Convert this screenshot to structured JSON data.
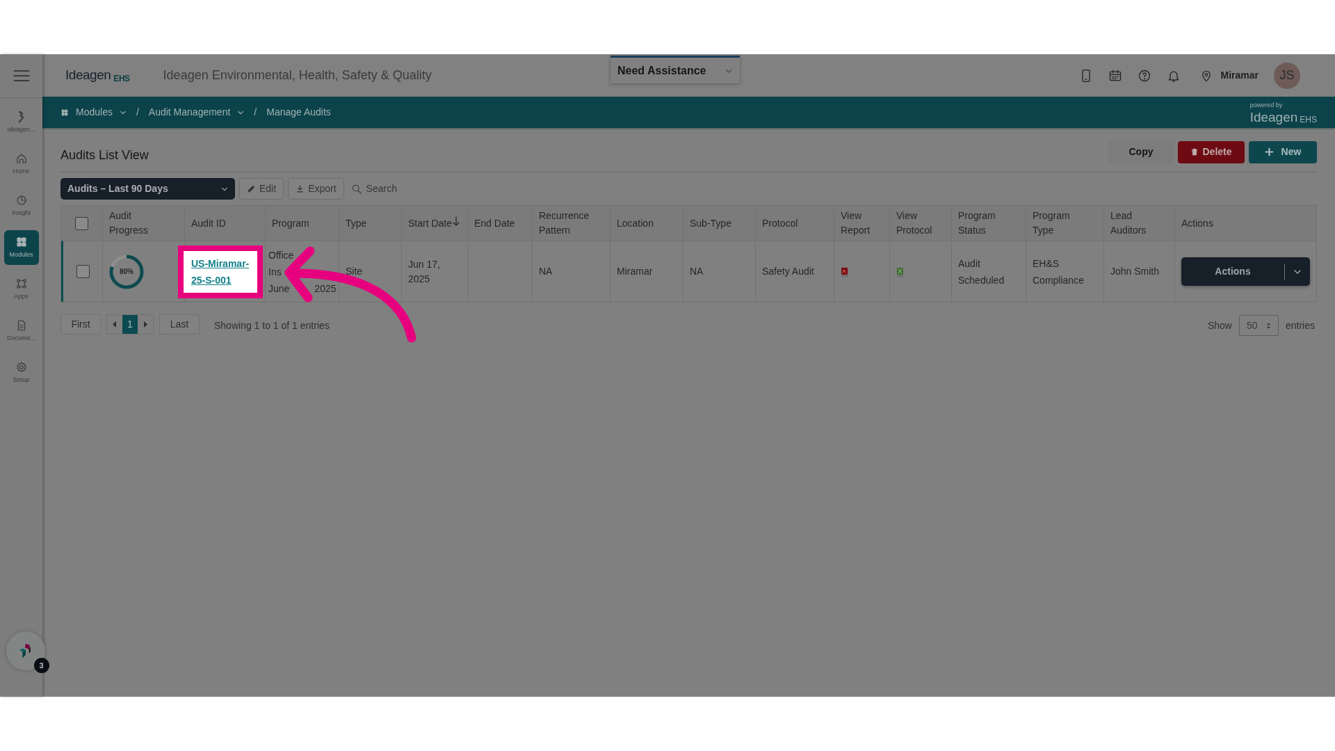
{
  "header": {
    "logo": "Ideagen",
    "logo_suffix": "EHS",
    "title": "Ideagen Environmental, Health, Safety & Quality",
    "assistance": "Need Assistance",
    "location": "Miramar",
    "avatar": "JS"
  },
  "breadcrumb_separator": "/",
  "breadcrumb": [
    {
      "label": "Modules",
      "dropdown": true
    },
    {
      "label": "Audit Management",
      "dropdown": true
    },
    {
      "label": "Manage Audits",
      "dropdown": false
    }
  ],
  "powered_by": {
    "caption": "powered by",
    "logo": "Ideagen",
    "suffix": "EHS"
  },
  "sidebar": [
    {
      "label": "Ideagen...",
      "selected": false
    },
    {
      "label": "Home",
      "selected": false
    },
    {
      "label": "Insight",
      "selected": false
    },
    {
      "label": "Modules",
      "selected": true
    },
    {
      "label": "Apps",
      "selected": false
    },
    {
      "label": "Docume...",
      "selected": false
    },
    {
      "label": "Setup",
      "selected": false
    }
  ],
  "page_title": "Audits List View",
  "header_buttons": [
    {
      "label": "Copy",
      "kind": "plain"
    },
    {
      "label": "Delete",
      "kind": "danger"
    },
    {
      "label": "New",
      "kind": "primary"
    }
  ],
  "view_select": "Audits – Last 90 Days",
  "toolbar": [
    {
      "label": "Edit"
    },
    {
      "label": "Export"
    }
  ],
  "search": {
    "placeholder": "Search"
  },
  "table": {
    "select_all_checked": false,
    "columns": [
      {
        "label": "Audit Progress",
        "sorted": false
      },
      {
        "label": "Audit ID",
        "sorted": false
      },
      {
        "label": "Program",
        "sorted": false
      },
      {
        "label": "Type",
        "sorted": false
      },
      {
        "label": "Start Date",
        "sorted": true
      },
      {
        "label": "End Date",
        "sorted": false
      },
      {
        "label": "Recurrence Pattern",
        "sorted": false
      },
      {
        "label": "Location",
        "sorted": false
      },
      {
        "label": "Sub-Type",
        "sorted": false
      },
      {
        "label": "Protocol",
        "sorted": false
      },
      {
        "label": "View Report",
        "sorted": false
      },
      {
        "label": "View Protocol",
        "sorted": false
      },
      {
        "label": "Program Status",
        "sorted": false
      },
      {
        "label": "Program Type",
        "sorted": false
      },
      {
        "label": "Lead Auditors",
        "sorted": false
      },
      {
        "label": "Actions",
        "sorted": false
      }
    ],
    "rows": [
      {
        "checked": false,
        "progress": "80%",
        "level": 0.8,
        "audit_id": "US-Miramar-25-S-001",
        "highlighted": true,
        "program": [
          "Office",
          "Ins",
          "June",
          "2025"
        ],
        "type": "Site",
        "start_date": "Jun 17, 2025",
        "recurrence": "NA",
        "location": "Miramar",
        "sub_type": "NA",
        "protocol": "Safety Audit",
        "program_status": "Audit Scheduled",
        "program_type": "EH&S Compliance",
        "lead_auditors": "John Smith",
        "action": "Actions"
      }
    ]
  },
  "pagination": {
    "first": "First",
    "pages": [
      {
        "label": "1",
        "selected": true
      }
    ],
    "last": "Last",
    "info": "Showing 1 to 1 of 1 entries",
    "show": "Show",
    "page_size": "50",
    "entries": "entries"
  },
  "help_widget": {
    "badge": "3"
  }
}
